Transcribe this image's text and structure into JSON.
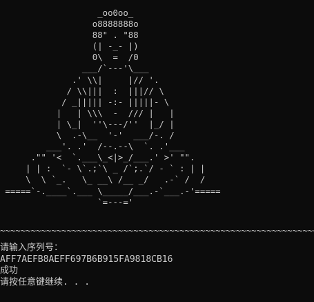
{
  "console": {
    "ascii_art": "                   _oo0oo_\n                  o8888888o\n                  88\" . \"88\n                  (| -_- |)\n                  0\\  =  /0\n                ___/`---'\\___\n              .' \\\\|     |// '.\n             / \\\\|||  :  |||// \\\n            / _||||| -:- |||||- \\\n           |   | \\\\\\  -  /// |   |\n           | \\_|  ''\\---/''  |_/ |\n           \\  .-\\__  '-'  ___/-. /\n         ___'. .'  /--.--\\  `. .'___\n      .\"\" '<  `.___\\_<|>_/___.' >' \"\".\n     | | :  `- \\`.;`\\ _ /`;.`/ - ` : | |\n     \\  \\ `_.   \\_ __\\ /__ _/   .-` /  /\n =====`-.____`.___ \\_____/___.-`___.-'=====\n                   `=---='",
    "divider": "~~~~~~~~~~~~~~~~~~~~~~~~~~~~~~~~~~~~~~~~~~~~~~~~~~~~~~~~~~~~~~~~~~~",
    "lines": [
      "请输入序列号：",
      "AFF7AEFB8AEFF697B6B915FA9818CB16",
      "成功",
      "请按任意键继续. . ."
    ]
  }
}
